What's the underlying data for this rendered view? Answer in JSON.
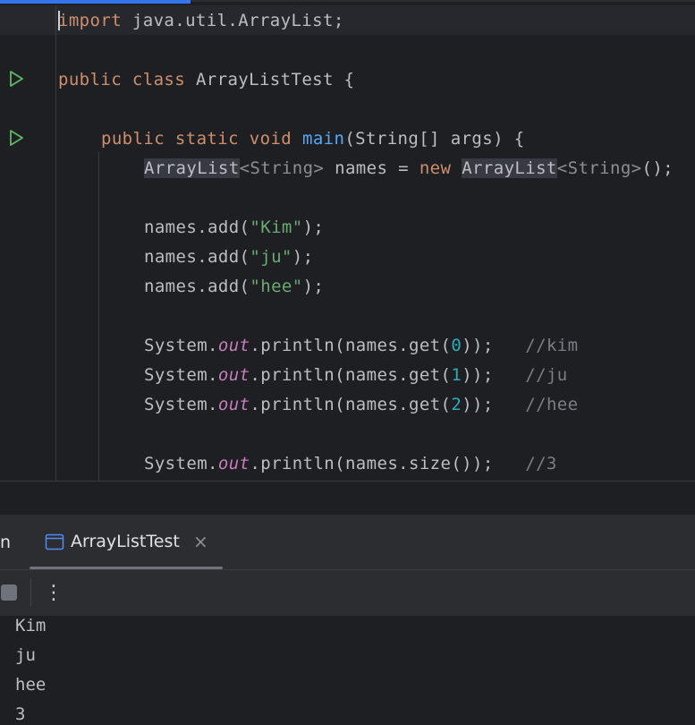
{
  "editor": {
    "lines": {
      "import_kw": "import",
      "import_rest": " java.util.ArrayList;",
      "class_public": "public",
      "class_kw": "class",
      "class_name": "ArrayListTest {",
      "m_public": "public",
      "m_static": "static",
      "m_void": "void",
      "m_name": "main",
      "m_params": "(String[] args) {",
      "decl_type": "ArrayList",
      "decl_generic1": "<String>",
      "decl_mid": " names = ",
      "decl_new": "new",
      "decl_type2": "ArrayList",
      "decl_generic2": "<String>",
      "decl_end": "();",
      "add_prefix": "names.add(",
      "add_suffix": ");",
      "add1": "\"Kim\"",
      "add2": "\"ju\"",
      "add3": "\"hee\"",
      "sys": "System.",
      "out": "out",
      "println_get": ".println(names.get(",
      "close": "));",
      "get0": "0",
      "get1": "1",
      "get2": "2",
      "cmt0": "//kim",
      "cmt1": "//ju",
      "cmt2": "//hee",
      "println_size": ".println(names.size());",
      "cmt3": "//3"
    }
  },
  "tool_window": {
    "title_fragment": "n",
    "tab_label": "ArrayListTest",
    "close_glyph": "×",
    "more_glyph": "⋮"
  },
  "console": {
    "output": [
      "Kim",
      "ju",
      "hee",
      "3"
    ]
  },
  "colors": {
    "accent": "#3574f0",
    "run_green": "#5fb865"
  }
}
